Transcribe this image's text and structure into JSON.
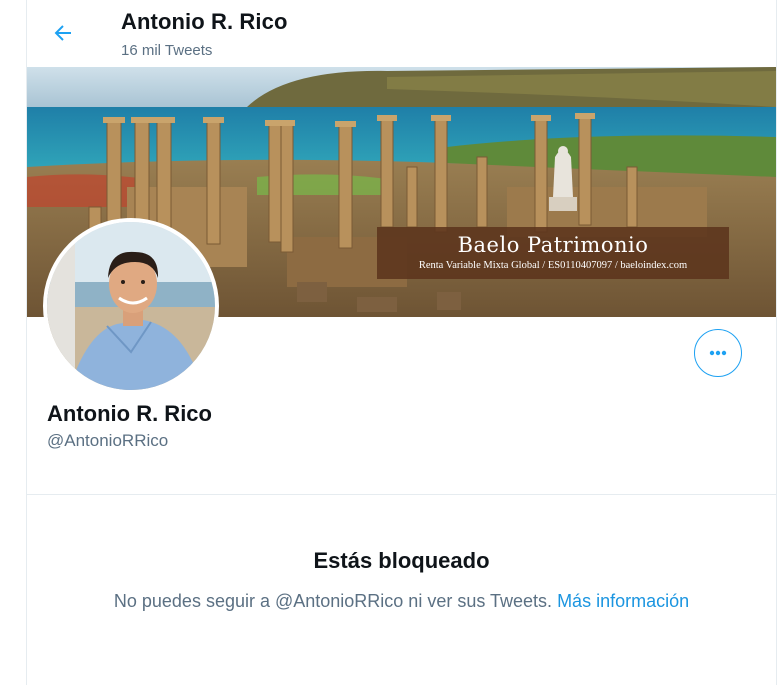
{
  "header": {
    "title": "Antonio R. Rico",
    "tweet_count": "16 mil Tweets",
    "back_icon": "arrow-left-icon"
  },
  "banner": {
    "title": "Baelo Patrimonio",
    "subtitle": "Renta Variable Mixta Global / ES0110407097 / baeloindex.com"
  },
  "profile": {
    "name": "Antonio R. Rico",
    "handle": "@AntonioRRico",
    "more_icon": "more-options-icon"
  },
  "blocked": {
    "title": "Estás bloqueado",
    "text": "No puedes seguir a @AntonioRRico ni ver sus Tweets.",
    "link": "Más información"
  },
  "colors": {
    "accent": "#1da1f2",
    "link": "#1b95e0",
    "secondary_text": "#5b7083",
    "border": "#e6ecf0"
  }
}
